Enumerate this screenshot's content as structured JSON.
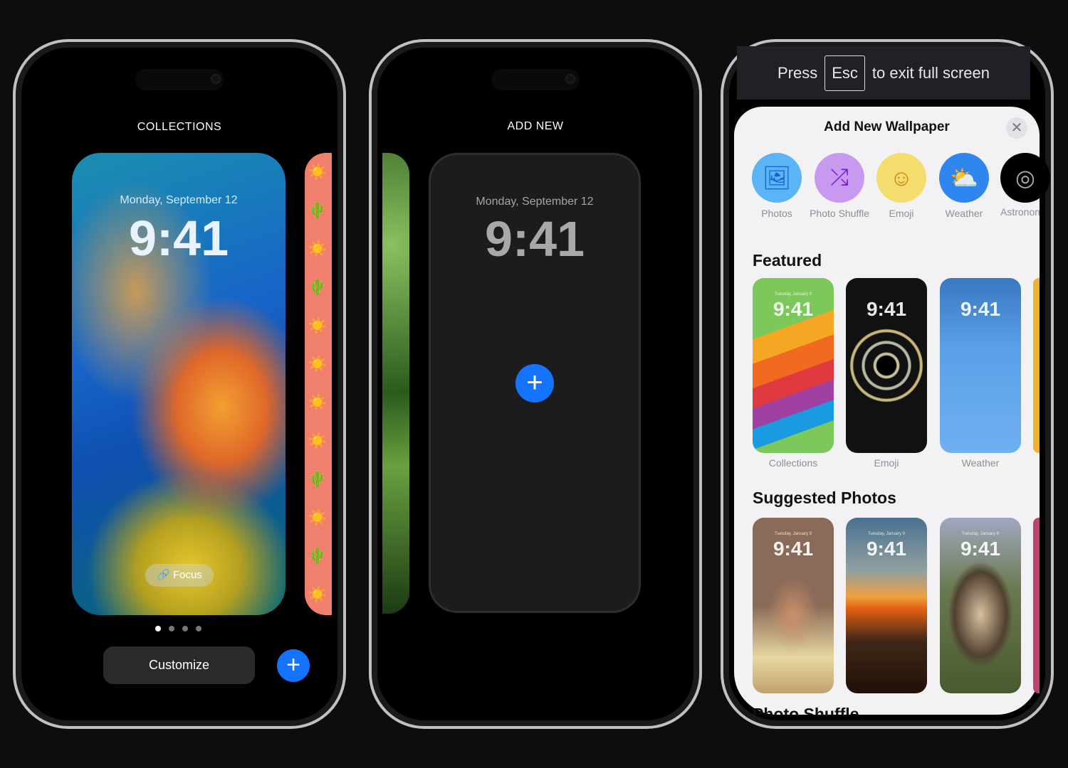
{
  "phone1": {
    "title": "COLLECTIONS",
    "date": "Monday, September 12",
    "time": "9:41",
    "focus": "Focus",
    "customize": "Customize",
    "page_dots": 4,
    "active_dot": 0
  },
  "phone2": {
    "title": "ADD NEW",
    "date": "Monday, September 12",
    "time": "9:41"
  },
  "fullscreen_banner": {
    "press": "Press",
    "key": "Esc",
    "rest": "to exit full screen"
  },
  "sheet": {
    "title": "Add New Wallpaper",
    "categories": [
      {
        "label": "Photos",
        "icon": "photos-icon",
        "color": "#5ab4f5"
      },
      {
        "label": "Photo Shuffle",
        "icon": "shuffle-icon",
        "color": "#c79af0"
      },
      {
        "label": "Emoji",
        "icon": "emoji-icon",
        "color": "#f5dc6e"
      },
      {
        "label": "Weather",
        "icon": "weather-icon",
        "color": "#2f86ee"
      },
      {
        "label": "Astronomy",
        "icon": "astronomy-icon",
        "color": "#000000"
      }
    ],
    "featured_heading": "Featured",
    "featured": [
      {
        "label": "Collections",
        "time": "9:41",
        "date": "Tuesday, January 9"
      },
      {
        "label": "Emoji",
        "time": "9:41",
        "date": ""
      },
      {
        "label": "Weather",
        "time": "9:41",
        "date": ""
      }
    ],
    "suggested_heading": "Suggested Photos",
    "suggested": [
      {
        "time": "9:41",
        "date": "Tuesday, January 9"
      },
      {
        "time": "9:41",
        "date": "Tuesday, January 9"
      },
      {
        "time": "9:41",
        "date": "Tuesday, January 9"
      }
    ],
    "next_heading": "Photo Shuffle"
  }
}
